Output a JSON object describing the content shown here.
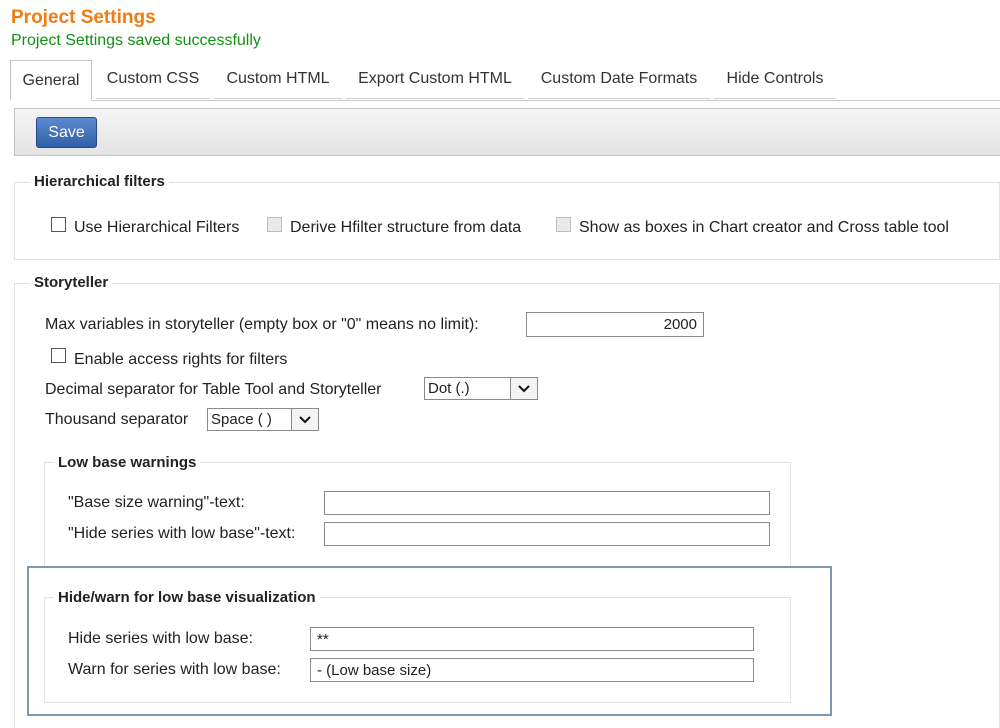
{
  "header": {
    "title": "Project Settings",
    "status": "Project Settings saved successfully"
  },
  "tabs": [
    {
      "label": "General",
      "active": true
    },
    {
      "label": "Custom CSS"
    },
    {
      "label": "Custom HTML"
    },
    {
      "label": "Export Custom HTML"
    },
    {
      "label": "Custom Date Formats"
    },
    {
      "label": "Hide Controls"
    }
  ],
  "toolbar": {
    "save_label": "Save"
  },
  "hierarchical": {
    "legend": "Hierarchical filters",
    "use_label": "Use Hierarchical Filters",
    "derive_label": "Derive Hfilter structure from data",
    "boxes_label": "Show as boxes in Chart creator and Cross table tool"
  },
  "storyteller": {
    "legend": "Storyteller",
    "max_vars_label": "Max variables in storyteller (empty box or \"0\" means no limit):",
    "max_vars_value": "2000",
    "access_label": "Enable access rights for filters",
    "decimal_label": "Decimal separator for Table Tool and Storyteller",
    "decimal_value": "Dot (.)",
    "thousand_label": "Thousand separator",
    "thousand_value": "Space ( )"
  },
  "low_base": {
    "legend": "Low base warnings",
    "base_warning_label": "\"Base size warning\"-text:",
    "base_warning_value": "",
    "hide_series_label": "\"Hide series with low base\"-text:",
    "hide_series_value": ""
  },
  "low_base_vis": {
    "legend": "Hide/warn for low base visualization",
    "hide_label": "Hide series with low base:",
    "hide_value": "**",
    "warn_label": "Warn for series with low base:",
    "warn_value": "- (Low base size)"
  }
}
